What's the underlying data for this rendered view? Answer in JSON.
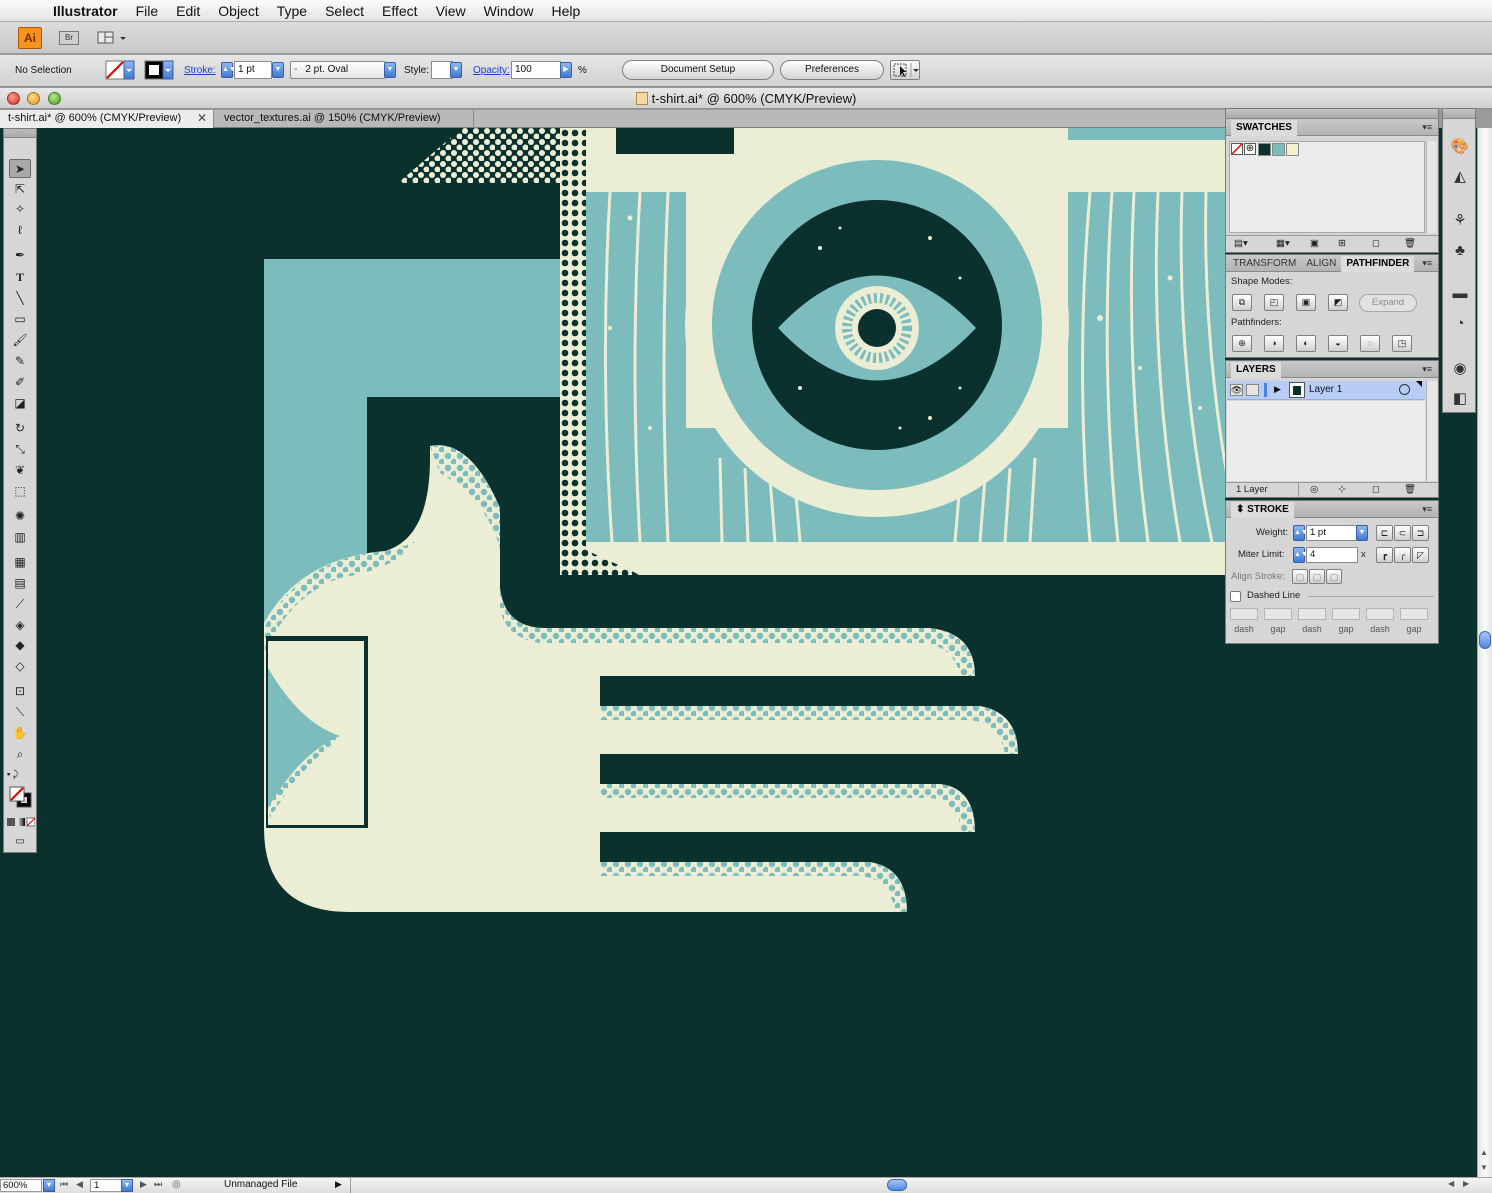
{
  "menubar": {
    "app_name": "Illustrator",
    "items": [
      "File",
      "Edit",
      "Object",
      "Type",
      "Select",
      "Effect",
      "View",
      "Window",
      "Help"
    ]
  },
  "appbar": {
    "logo_label": "Ai",
    "bridge_label": "Br"
  },
  "control_bar": {
    "selection_status": "No Selection",
    "stroke_label": "Stroke:",
    "stroke_weight": "1 pt",
    "brush_value": "2 pt. Oval",
    "style_label": "Style:",
    "opacity_label": "Opacity:",
    "opacity_value": "100",
    "opacity_unit": "%",
    "document_setup_label": "Document Setup",
    "preferences_label": "Preferences"
  },
  "document": {
    "window_title": "t-shirt.ai* @ 600% (CMYK/Preview)",
    "tabs": [
      {
        "label": "t-shirt.ai* @ 600% (CMYK/Preview)",
        "active": true
      },
      {
        "label": "vector_textures.ai @ 150% (CMYK/Preview)",
        "active": false
      }
    ]
  },
  "artwork_colors": {
    "background": "#0a312e",
    "teal": "#7dbcbd",
    "cream": "#ebedd4"
  },
  "swatches_panel": {
    "title": "SWATCHES",
    "swatch_colors": [
      "#0a312e",
      "#7dbcbd",
      "#f1f0d0"
    ]
  },
  "pathfinder_panel": {
    "tabs": [
      "TRANSFORM",
      "ALIGN",
      "PATHFINDER"
    ],
    "active_tab": "PATHFINDER",
    "shape_modes_label": "Shape Modes:",
    "expand_label": "Expand",
    "pathfinders_label": "Pathfinders:"
  },
  "layers_panel": {
    "title": "LAYERS",
    "layers": [
      {
        "name": "Layer 1"
      }
    ],
    "layer_count": "1 Layer"
  },
  "stroke_panel": {
    "title": "STROKE",
    "weight_label": "Weight:",
    "weight_value": "1 pt",
    "miter_label": "Miter Limit:",
    "miter_value": "4",
    "miter_unit": "x",
    "align_label": "Align Stroke:",
    "dashed_label": "Dashed Line",
    "dash_labels": [
      "dash",
      "gap",
      "dash",
      "gap",
      "dash",
      "gap"
    ]
  },
  "status_bar": {
    "zoom": "600%",
    "artboard_number": "1",
    "status_text": "Unmanaged File"
  }
}
